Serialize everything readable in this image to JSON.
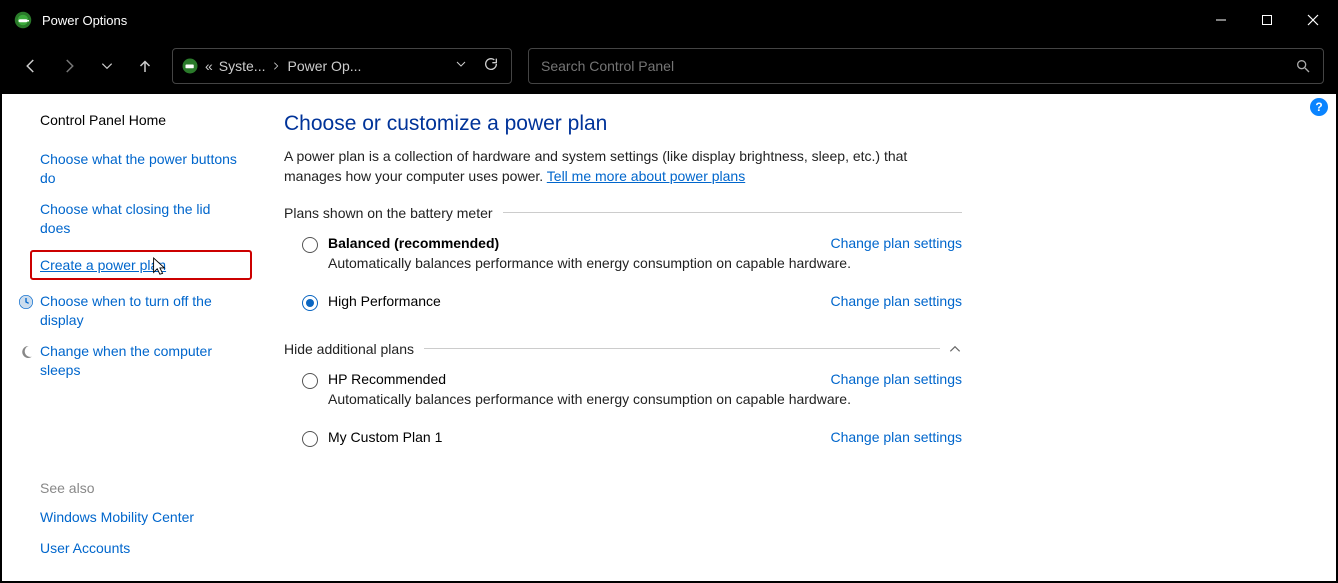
{
  "window": {
    "title": "Power Options"
  },
  "address": {
    "prefix": "«",
    "crumb1": "Syste...",
    "crumb2": "Power Op..."
  },
  "search": {
    "placeholder": "Search Control Panel"
  },
  "sidebar": {
    "home": "Control Panel Home",
    "links": [
      {
        "label": "Choose what the power buttons do"
      },
      {
        "label": "Choose what closing the lid does"
      },
      {
        "label": "Create a power plan",
        "highlighted": true
      },
      {
        "label": "Choose when to turn off the display",
        "icon": "clock"
      },
      {
        "label": "Change when the computer sleeps",
        "icon": "moon"
      }
    ],
    "see_also_header": "See also",
    "see_also": [
      {
        "label": "Windows Mobility Center"
      },
      {
        "label": "User Accounts"
      }
    ]
  },
  "main": {
    "heading": "Choose or customize a power plan",
    "intro_text": "A power plan is a collection of hardware and system settings (like display brightness, sleep, etc.) that manages how your computer uses power. ",
    "intro_link": "Tell me more about power plans",
    "section1_header": "Plans shown on the battery meter",
    "plans1": [
      {
        "title": "Balanced (recommended)",
        "bold": true,
        "selected": false,
        "desc": "Automatically balances performance with energy consumption on capable hardware.",
        "change": "Change plan settings"
      },
      {
        "title": "High Performance",
        "bold": false,
        "selected": true,
        "desc": "",
        "change": "Change plan settings"
      }
    ],
    "section2_header": "Hide additional plans",
    "plans2": [
      {
        "title": "HP Recommended",
        "bold": false,
        "selected": false,
        "desc": "Automatically balances performance with energy consumption on capable hardware.",
        "change": "Change plan settings"
      },
      {
        "title": "My Custom Plan 1",
        "bold": false,
        "selected": false,
        "desc": "",
        "change": "Change plan settings"
      }
    ]
  }
}
